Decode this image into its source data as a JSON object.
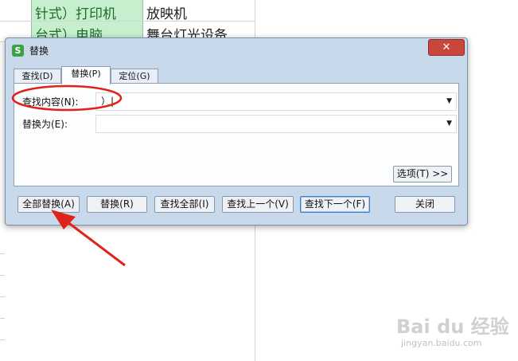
{
  "sheet": {
    "rows": [
      {
        "col_a": "针式）打印机",
        "col_b": "放映机"
      },
      {
        "col_a": "台式）电脑",
        "col_b": "舞台灯光设备"
      }
    ]
  },
  "dialog": {
    "title": "替换",
    "app_icon": "S",
    "close_label": "✕",
    "tabs": [
      {
        "label": "查找(D)",
        "active": false
      },
      {
        "label": "替换(P)",
        "active": true
      },
      {
        "label": "定位(G)",
        "active": false
      }
    ],
    "find": {
      "label": "查找内容(N):",
      "value": "）|"
    },
    "replace": {
      "label": "替换为(E):",
      "value": ""
    },
    "options_label": "选项(T) >>",
    "buttons": {
      "replace_all": "全部替换(A)",
      "replace": "替换(R)",
      "find_all": "查找全部(I)",
      "find_prev": "查找上一个(V)",
      "find_next": "查找下一个(F)",
      "close": "关闭"
    }
  },
  "watermark": {
    "text": "Bai du 经验",
    "url": "jingyan.baidu.com"
  },
  "colors": {
    "annotation": "#e0231a",
    "dialog_bg": "#c9d9ec",
    "cell_green": "#c6efce"
  }
}
